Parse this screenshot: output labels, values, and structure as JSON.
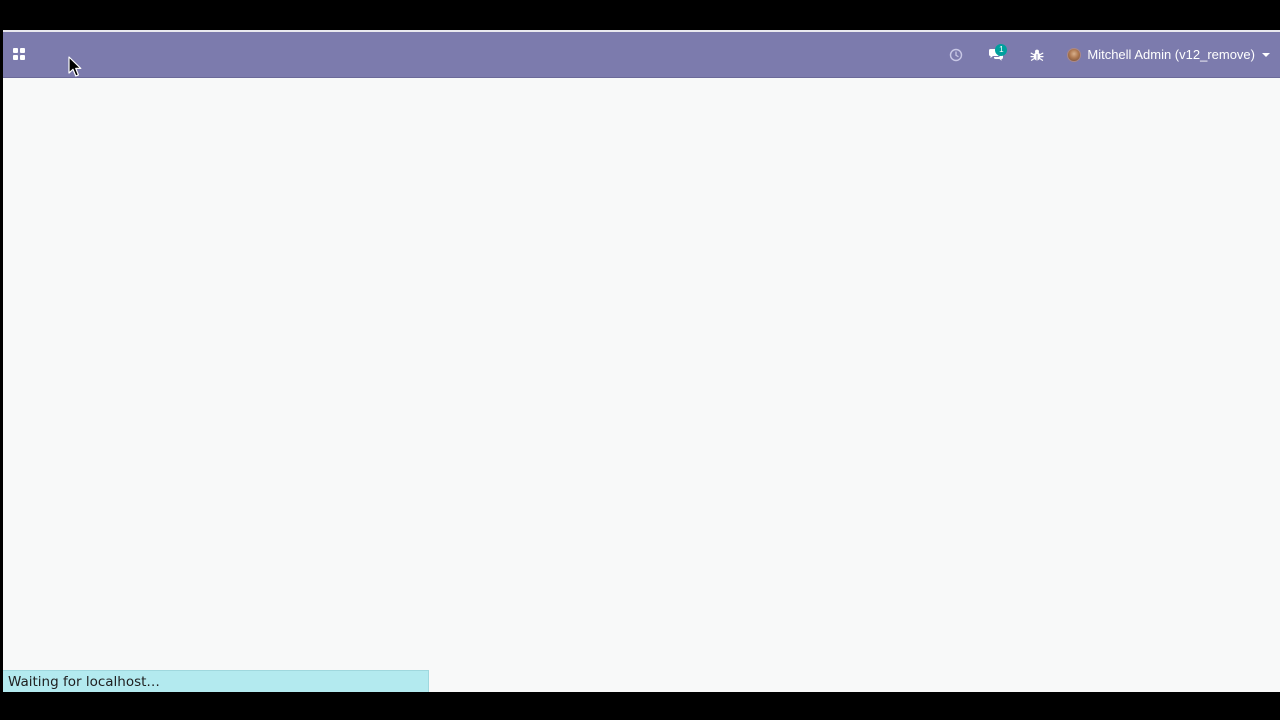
{
  "navbar": {
    "apps_icon": "apps-grid-icon",
    "activity_icon": "clock-icon",
    "messaging_icon": "chat-bubbles-icon",
    "messaging_badge": "1",
    "debug_icon": "bug-icon",
    "user_name": "Mitchell Admin (v12_remove)",
    "user_menu_icon": "caret-down-icon",
    "background_color": "#7c7bad"
  },
  "status_bar": {
    "text": "Waiting for localhost…",
    "background_color": "#b3eaef"
  },
  "content": {
    "background_color": "#f8f9f9"
  }
}
